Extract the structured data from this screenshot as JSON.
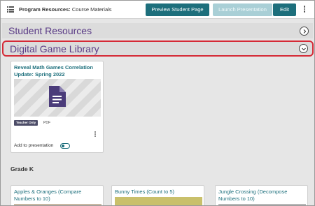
{
  "topbar": {
    "crumb_bold": "Program Resources:",
    "crumb_rest": " Course Materials",
    "preview_label": "Preview Student Page",
    "launch_label": "Launch Presentation",
    "edit_label": "Edit"
  },
  "sections": {
    "student": "Student Resources",
    "game": "Digital Game Library"
  },
  "card": {
    "title": "Reveal Math Games Correlation Update: Spring 2022",
    "badge": "Teacher Only",
    "format": "PDF",
    "add_label": "Add to presentation",
    "add_enabled": false
  },
  "grade_label": "Grade K",
  "games": [
    {
      "title": "Apples & Oranges (Compare Numbers to 10)"
    },
    {
      "title": "Bunny Times (Count to 5)"
    },
    {
      "title": "Jungle Crossing (Decompose Numbers to 10)"
    }
  ],
  "colors": {
    "accent": "#1d6f7c",
    "section_title": "#5a3b86",
    "highlight_border": "#d52a36"
  }
}
